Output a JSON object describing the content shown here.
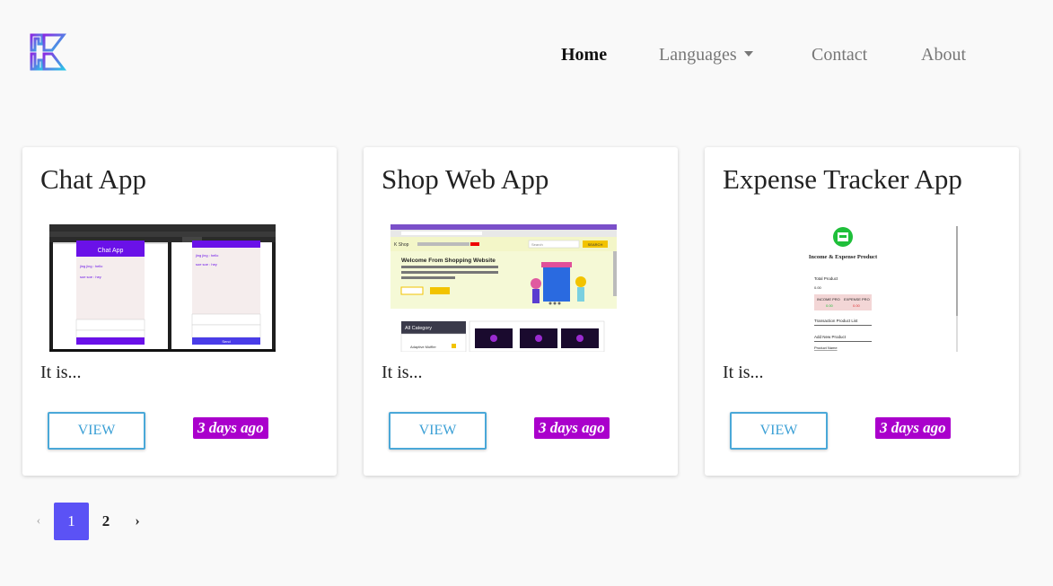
{
  "nav": {
    "items": [
      {
        "label": "Home",
        "active": true
      },
      {
        "label": "Languages",
        "dropdown": true
      },
      {
        "label": "Contact"
      },
      {
        "label": "About"
      }
    ]
  },
  "cards": [
    {
      "title": "Chat App",
      "desc": "It is...",
      "view_label": "VIEW",
      "time": "3 days ago",
      "shot": {
        "left_label": "Chat App",
        "line1": "jing jing : hello",
        "line2": "soe soe : hey",
        "button": "Send"
      }
    },
    {
      "title": "Shop Web App",
      "desc": "It is...",
      "view_label": "VIEW",
      "time": "3 days ago",
      "shot": {
        "brand": "K Shop",
        "search": "Search",
        "search_btn": "SEARCH",
        "hero": "Welcome From Shopping Website",
        "category": "All Category",
        "item": "Adaptive Muffler"
      }
    },
    {
      "title": "Expense Tracker App",
      "desc": "It is...",
      "view_label": "VIEW",
      "time": "3 days ago",
      "shot": {
        "heading": "Income & Expense Product",
        "total": "Total Product",
        "total_value": "0.00",
        "income": "INCOME PRO",
        "expense": "EXPENSE PRO",
        "list": "Transaction Product List",
        "add": "Add New Product",
        "name": "Product Name"
      }
    }
  ],
  "pagination": {
    "prev": "‹",
    "pages": [
      "1",
      "2"
    ],
    "current": "1",
    "next": "›"
  },
  "colors": {
    "accent": "#5b52f5",
    "badge": "#aa00cc",
    "view_border": "#4aa8d8",
    "logo_purple": "#7a3cf0",
    "logo_cyan": "#2cc3e6"
  }
}
